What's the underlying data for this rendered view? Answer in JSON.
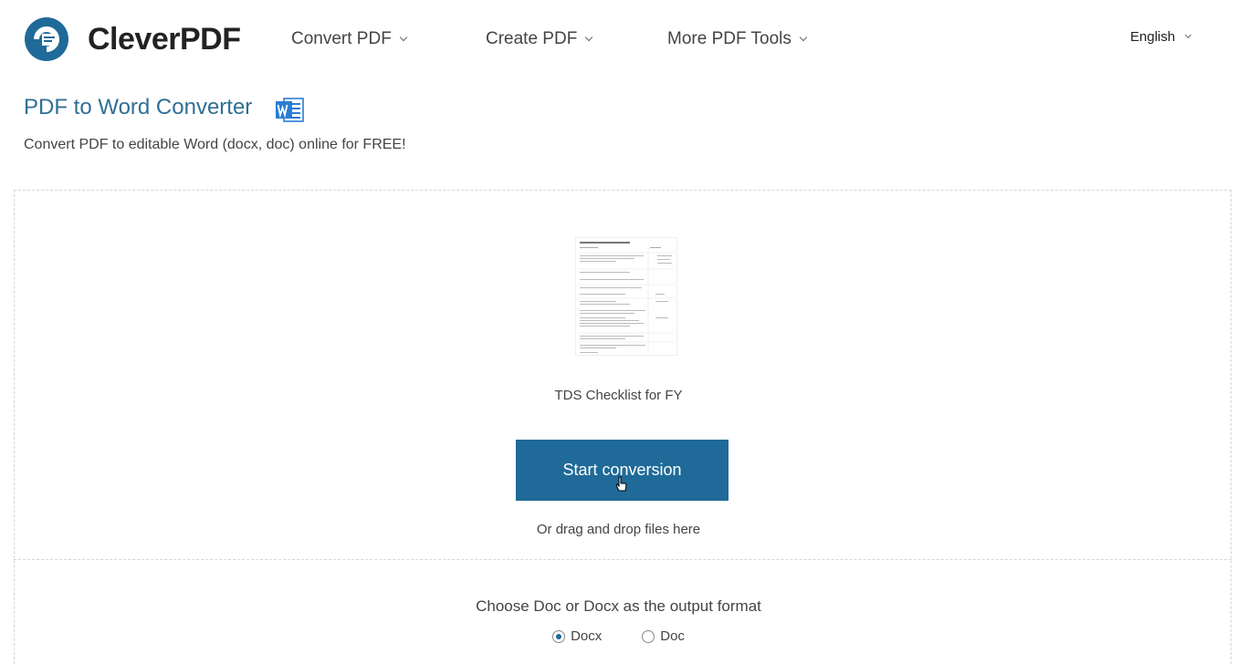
{
  "header": {
    "logo_text": "CleverPDF",
    "nav": [
      {
        "label": "Convert PDF"
      },
      {
        "label": "Create PDF"
      },
      {
        "label": "More PDF Tools"
      }
    ],
    "language": "English"
  },
  "page": {
    "title": "PDF to Word Converter",
    "subtitle": "Convert PDF to editable Word (docx, doc) online for FREE!"
  },
  "upload": {
    "file_name": "TDS Checklist for FY",
    "start_button": "Start conversion",
    "drag_hint": "Or drag and drop files here"
  },
  "output": {
    "label": "Choose Doc or Docx as the output format",
    "options": [
      {
        "label": "Docx",
        "selected": true
      },
      {
        "label": "Doc",
        "selected": false
      }
    ]
  },
  "colors": {
    "brand_blue": "#1f6a98",
    "title_blue": "#2f6f95",
    "word_blue": "#2b7cd3"
  },
  "icons": [
    "cleverpdf-logo-icon",
    "word-file-icon",
    "pointer-cursor-icon"
  ]
}
